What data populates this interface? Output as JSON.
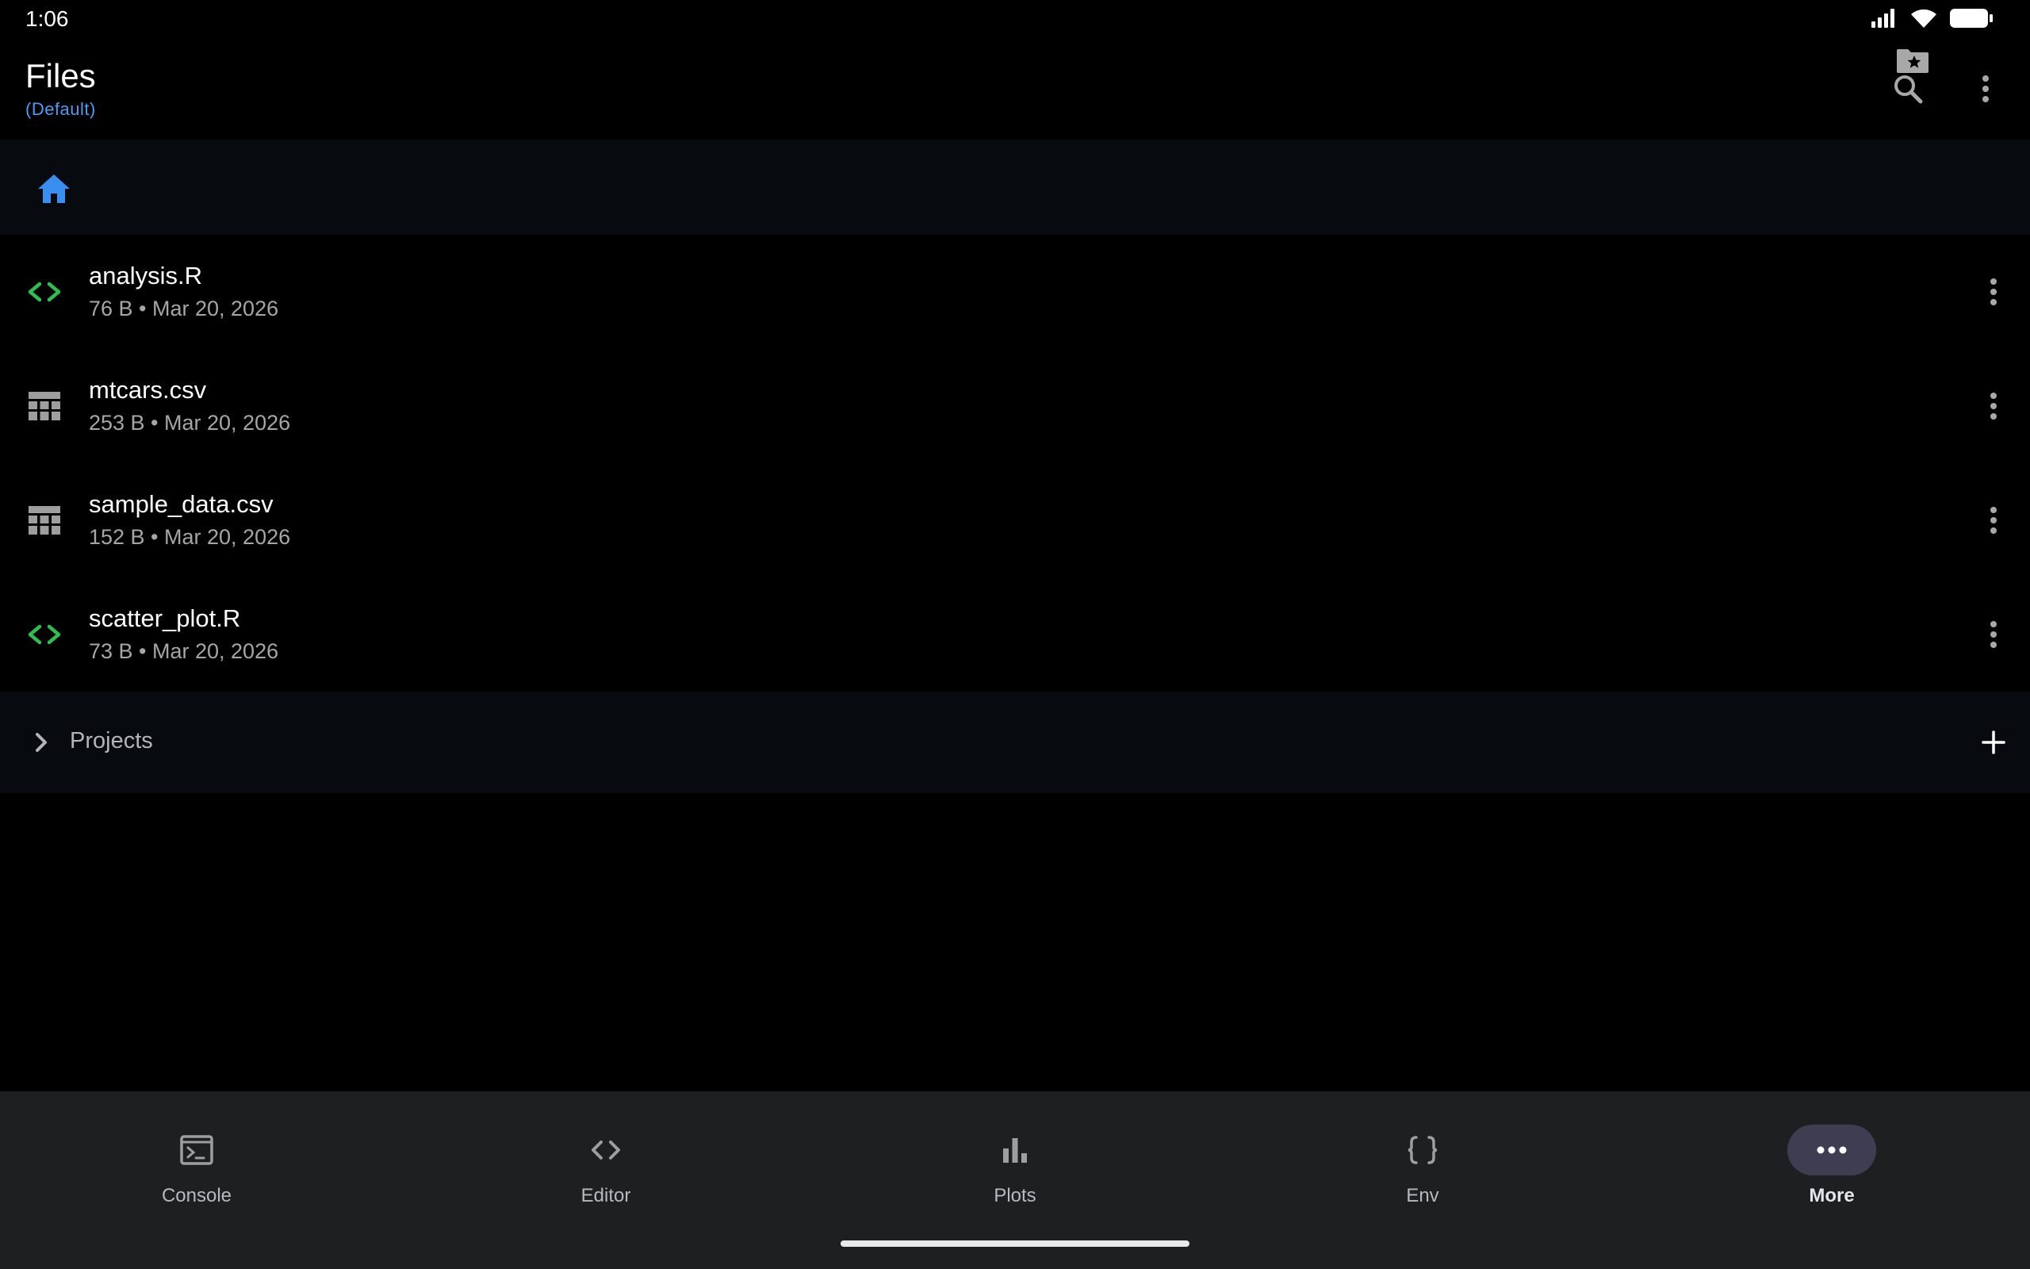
{
  "status": {
    "time": "1:06"
  },
  "header": {
    "title": "Files",
    "subtitle": "(Default)"
  },
  "files": [
    {
      "name": "analysis.R",
      "meta": "76 B • Mar 20, 2026",
      "icon": "code-icon"
    },
    {
      "name": "mtcars.csv",
      "meta": "253 B • Mar 20, 2026",
      "icon": "table-icon"
    },
    {
      "name": "sample_data.csv",
      "meta": "152 B • Mar 20, 2026",
      "icon": "table-icon"
    },
    {
      "name": "scatter_plot.R",
      "meta": "73 B • Mar 20, 2026",
      "icon": "code-icon"
    }
  ],
  "projects": {
    "label": "Projects"
  },
  "nav": {
    "items": [
      {
        "label": "Console",
        "icon": "terminal-icon"
      },
      {
        "label": "Editor",
        "icon": "code-icon"
      },
      {
        "label": "Plots",
        "icon": "bar-chart-icon"
      },
      {
        "label": "Env",
        "icon": "braces-icon"
      },
      {
        "label": "More",
        "icon": "more-horiz-icon",
        "active": true
      }
    ]
  },
  "colors": {
    "background": "#000000",
    "accent_blue": "#4a9cf5",
    "code_icon_green": "#2fbf4f",
    "nav_background": "#1e1f21",
    "nav_active_pill": "#3f3d52"
  }
}
